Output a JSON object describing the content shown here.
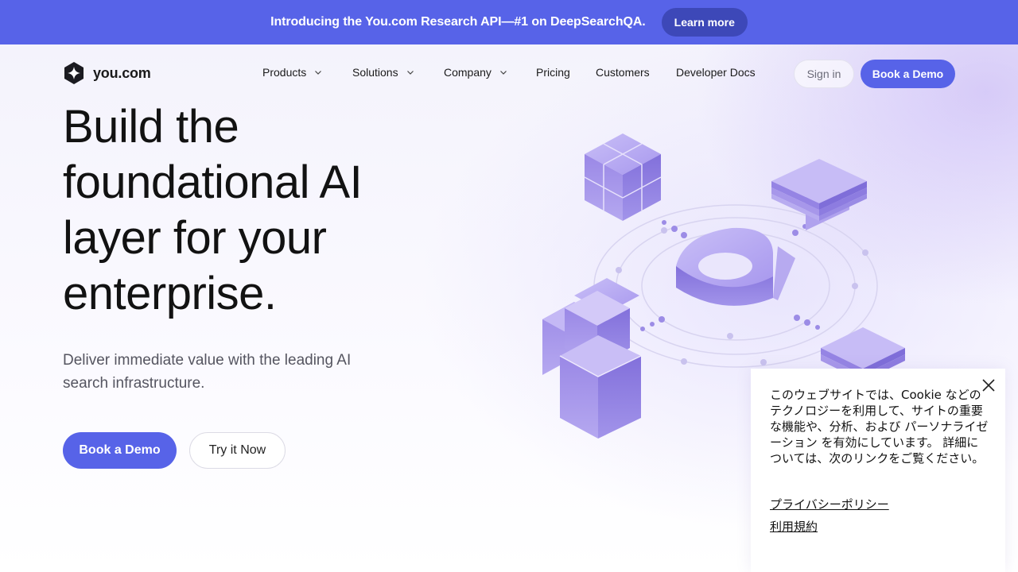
{
  "announcement": {
    "text": "Introducing the You.com Research API—#1 on DeepSearchQA.",
    "button_label": "Learn more"
  },
  "nav": {
    "brand": "you.com",
    "items": [
      {
        "label": "Products",
        "has_dropdown": true
      },
      {
        "label": "Solutions",
        "has_dropdown": true
      },
      {
        "label": "Company",
        "has_dropdown": true
      },
      {
        "label": "Pricing",
        "has_dropdown": false
      },
      {
        "label": "Customers",
        "has_dropdown": false
      },
      {
        "label": "Developer Docs",
        "has_dropdown": false
      }
    ],
    "signin_label": "Sign in",
    "demo_label": "Book a Demo"
  },
  "hero": {
    "title_lines": [
      "Build the",
      "foundational AI",
      "layer for your",
      "enterprise."
    ],
    "subtitle": "Deliver immediate value with the leading AI search infrastructure.",
    "primary_cta": "Book a Demo",
    "secondary_cta": "Try it Now"
  },
  "cookie_banner": {
    "text": "このウェブサイトでは、Cookie などのテクノロジーを利用して、サイトの重要な機能や、分析、および パーソナライゼーション を有効にしています。 詳細については、次のリンクをご覧ください。",
    "privacy_link": "プライバシーポリシー",
    "terms_link": "利用規約",
    "close_icon": "close-icon"
  },
  "colors": {
    "accent": "#5763e8",
    "accent_dark": "#3d48b8",
    "illustration_purple": "#8f7fe0"
  }
}
